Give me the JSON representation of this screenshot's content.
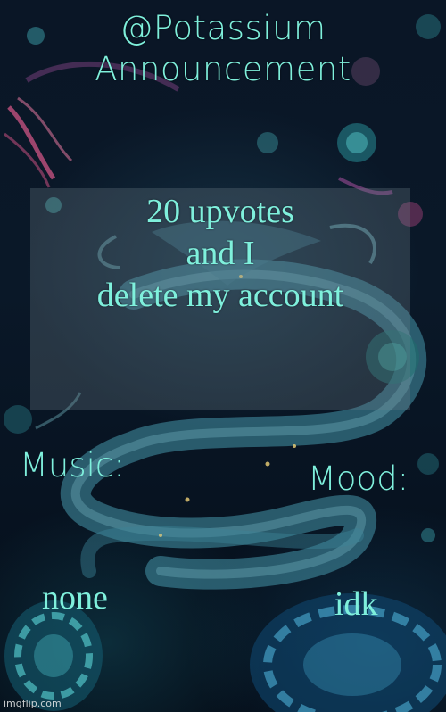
{
  "header": {
    "line1": "@Potassium",
    "line2": "Announcement"
  },
  "message": {
    "line1": "20 upvotes",
    "line2": "and I",
    "line3": "delete my account"
  },
  "music": {
    "label": "Music:",
    "value": "none"
  },
  "mood": {
    "label": "Mood:",
    "value": "idk"
  },
  "watermark": "imgflip.com",
  "colors": {
    "text": "#7ff0dc",
    "background": "#0a1626"
  }
}
